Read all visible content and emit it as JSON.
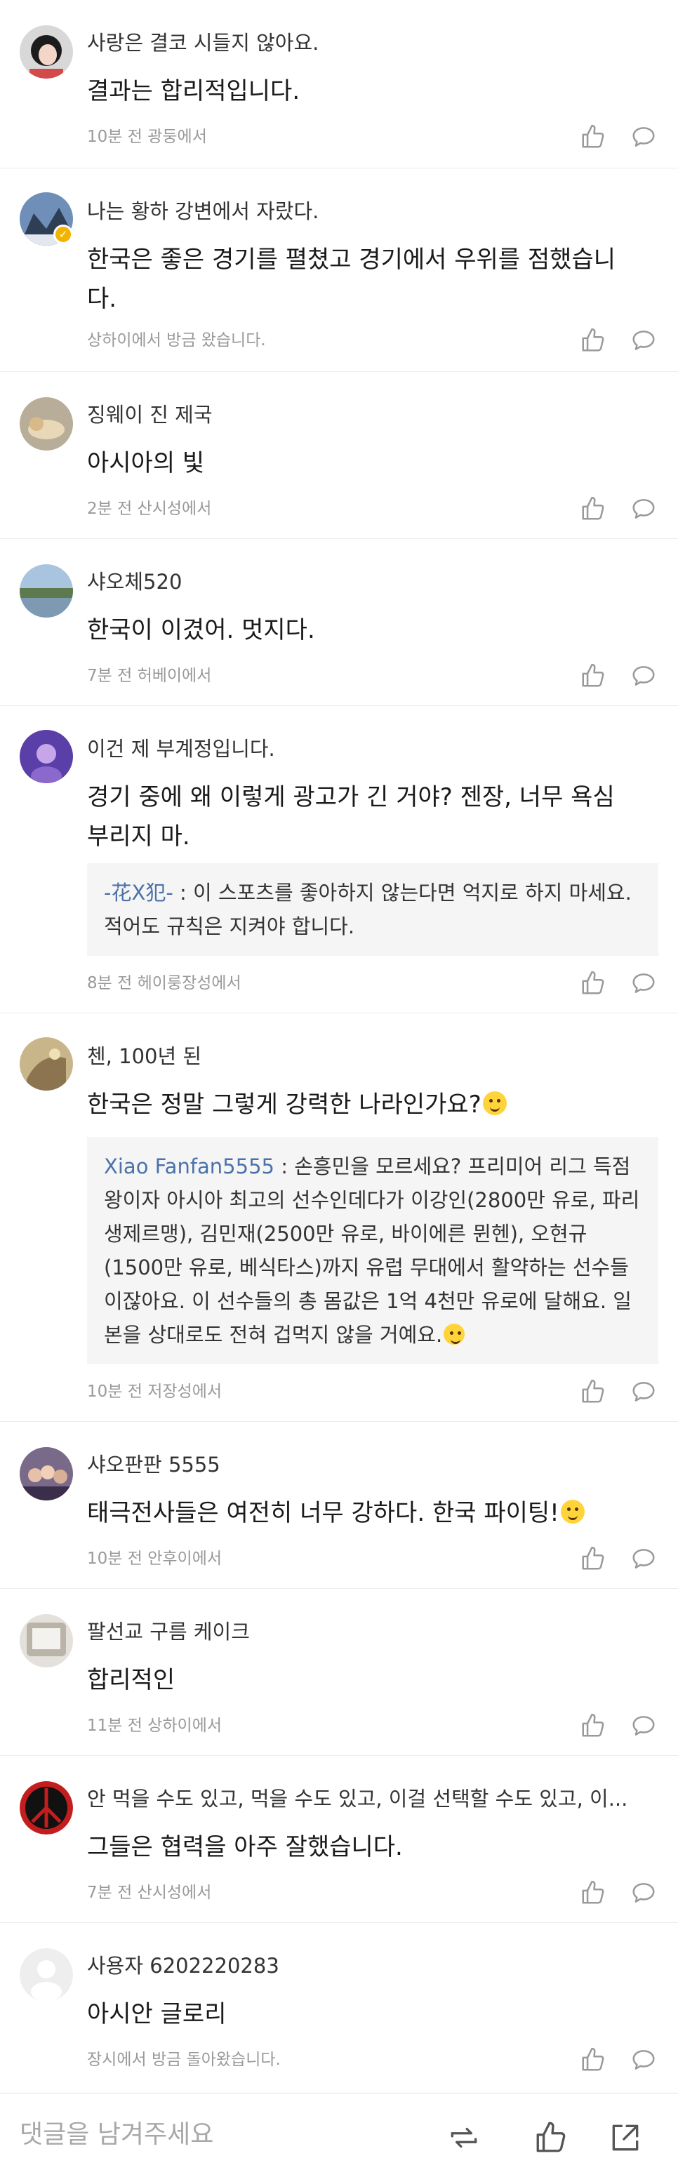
{
  "comments": [
    {
      "user": "사랑은 결코 시들지 않아요.",
      "text": "결과는 합리적입니다.",
      "meta": "10분 전 광둥에서"
    },
    {
      "user": "나는 황하 강변에서 자랐다.",
      "text": "한국은 좋은 경기를 펼쳤고 경기에서 우위를 점했습니다.",
      "meta": "상하이에서 방금 왔습니다.",
      "verified": true
    },
    {
      "user": "징웨이 진 제국",
      "text": "아시아의 빛",
      "meta": "2분 전 산시성에서"
    },
    {
      "user": "샤오체520",
      "text": "한국이 이겼어. 멋지다.",
      "meta": "7분 전 허베이에서"
    },
    {
      "user": "이건 제 부계정입니다.",
      "text": "경기 중에 왜 이렇게 광고가 긴 거야? 젠장, 너무 욕심 부리지 마.",
      "meta": "8분 전 헤이룽장성에서",
      "reply": {
        "user": "-花X犯-",
        "sep": " : ",
        "text": "이 스포츠를 좋아하지 않는다면 억지로 하지 마세요. 적어도 규칙은 지켜야 합니다."
      }
    },
    {
      "user": "첸, 100년 된",
      "text": "한국은 정말 그렇게 강력한 나라인가요?",
      "meta": "10분 전 저장성에서",
      "emoji": "laughing-emoji",
      "reply": {
        "user": "Xiao Fanfan5555",
        "sep": " : ",
        "text": "손흥민을 모르세요? 프리미어 리그 득점왕이자 아시아 최고의 선수인데다가 이강인(2800만 유로, 파리 생제르맹), 김민재(2500만 유로, 바이에른 뮌헨), 오현규(1500만 유로, 베식타스)까지 유럽 무대에서 활약하는 선수들이잖아요. 이 선수들의 총 몸값은 1억 4천만 유로에 달해요. 일본을 상대로도 전혀 겁먹지 않을 거예요.",
        "emoji": "smirk-emoji"
      }
    },
    {
      "user": "샤오판판 5555",
      "text": "태극전사들은 여전히 너무 강하다. 한국 파이팅!",
      "meta": "10분 전 안후이에서",
      "emoji": "kiss-emoji"
    },
    {
      "user": "팔선교 구름 케이크",
      "text": "합리적인",
      "meta": "11분 전 상하이에서"
    },
    {
      "user": "안 먹을 수도 있고, 먹을 수도 있고, 이걸 선택할 수도 있고, 이...",
      "text": "그들은 협력을 아주 잘했습니다.",
      "meta": "7분 전 산시성에서"
    },
    {
      "user": "사용자 6202220283",
      "text": "아시안 글로리",
      "meta": "장시에서 방금 돌아왔습니다."
    }
  ],
  "bottom_bar": {
    "placeholder": "댓글을 남겨주세요",
    "icons": [
      "repost-icon",
      "like-icon",
      "share-icon"
    ]
  },
  "colors": {
    "reply_user": "#4a72a8",
    "meta": "#999999",
    "reply_bg": "#f5f5f5"
  }
}
